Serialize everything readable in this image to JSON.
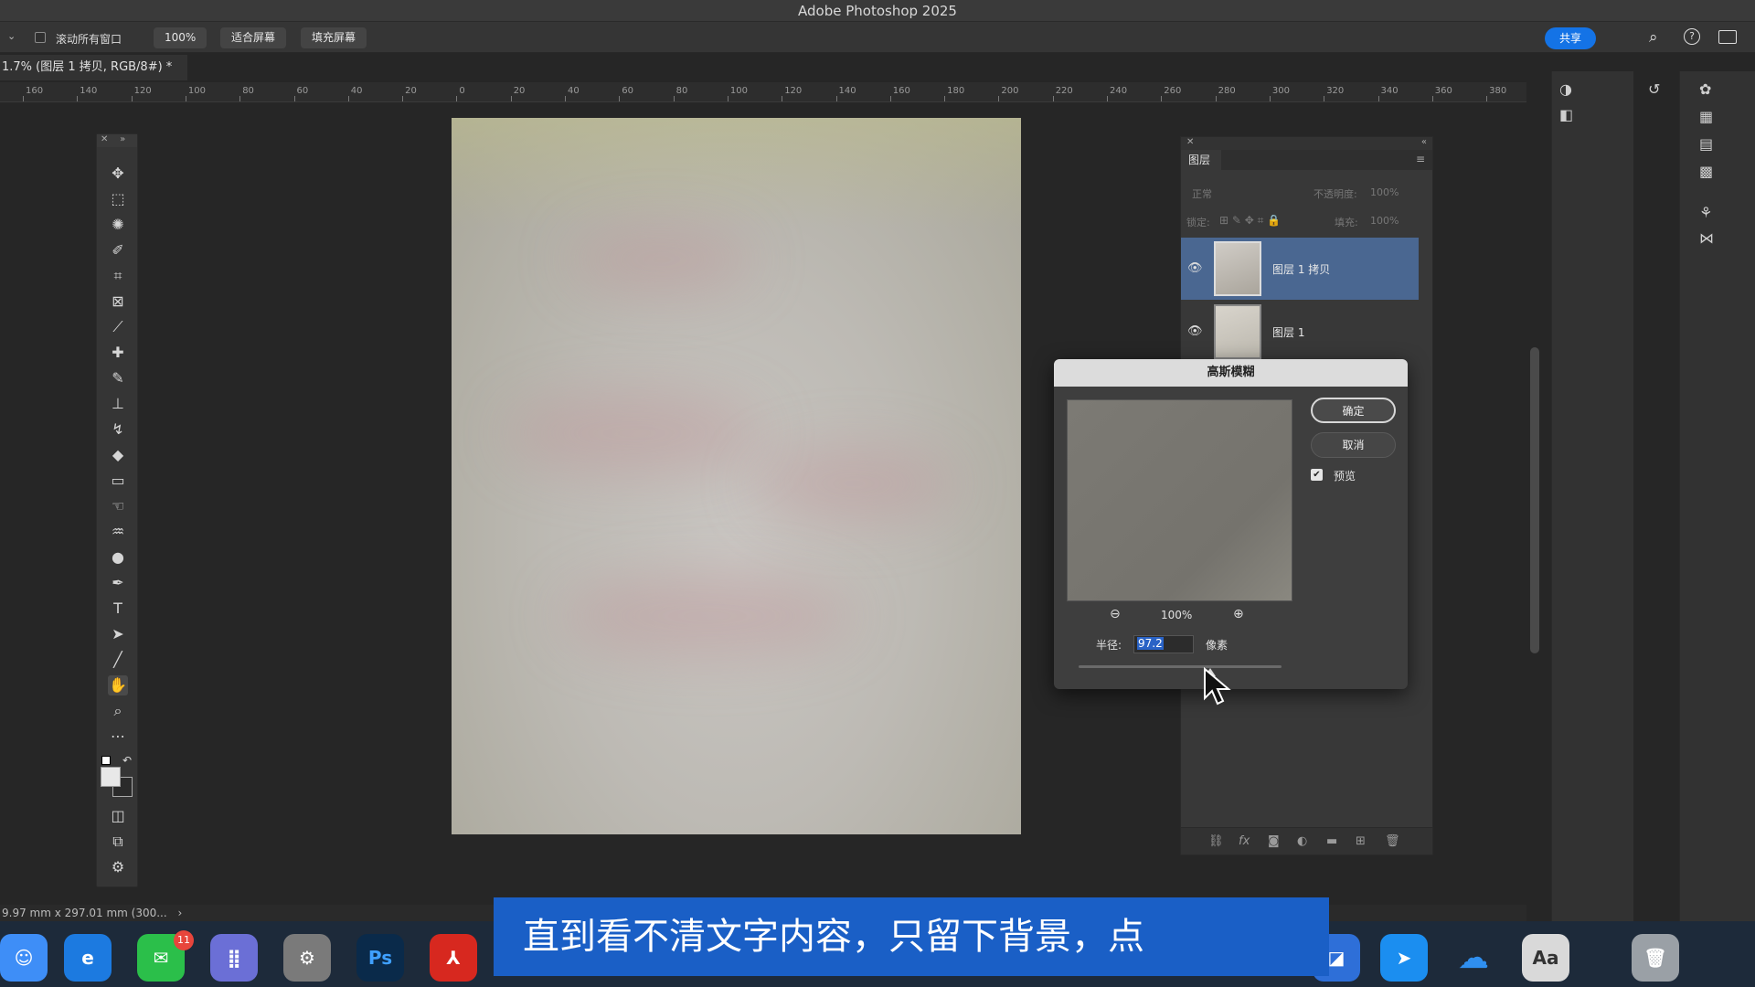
{
  "window": {
    "title": "Adobe Photoshop 2025"
  },
  "options_bar": {
    "scroll_all_label": "滚动所有窗口",
    "zoom_value": "100%",
    "fit_screen_label": "适合屏幕",
    "fill_screen_label": "填充屏幕",
    "share_label": "共享"
  },
  "document": {
    "tab_label": "1.7% (图层 1 拷贝, RGB/8#) *"
  },
  "ruler": {
    "labels": [
      "160",
      "140",
      "120",
      "100",
      "80",
      "60",
      "40",
      "20",
      "0",
      "20",
      "40",
      "60",
      "80",
      "100",
      "120",
      "140",
      "160",
      "180",
      "200",
      "220",
      "240",
      "260",
      "280",
      "300",
      "320",
      "340",
      "360",
      "380"
    ]
  },
  "layers_panel": {
    "tab_label": "图层",
    "blend_mode": "正常",
    "opacity_label": "不透明度:",
    "opacity_value": "100%",
    "lock_label": "锁定:",
    "fill_label": "填充:",
    "fill_value": "100%",
    "layers": [
      {
        "name": "图层 1 拷贝",
        "selected": true,
        "visible": true
      },
      {
        "name": "图层 1",
        "selected": false,
        "visible": true
      }
    ]
  },
  "dialog": {
    "title": "高斯模糊",
    "ok_label": "确定",
    "cancel_label": "取消",
    "preview_label": "预览",
    "preview_checked": true,
    "zoom_value": "100%",
    "radius_label": "半径:",
    "radius_value": "97.2",
    "radius_unit": "像素"
  },
  "status_bar": {
    "text": "9.97 mm x 297.01 mm (300..."
  },
  "dock": {
    "wechat_badge": "11",
    "photoshop_label": "Ps"
  },
  "subtitle": {
    "text": "直到看不清文字内容，只留下背景，点"
  }
}
